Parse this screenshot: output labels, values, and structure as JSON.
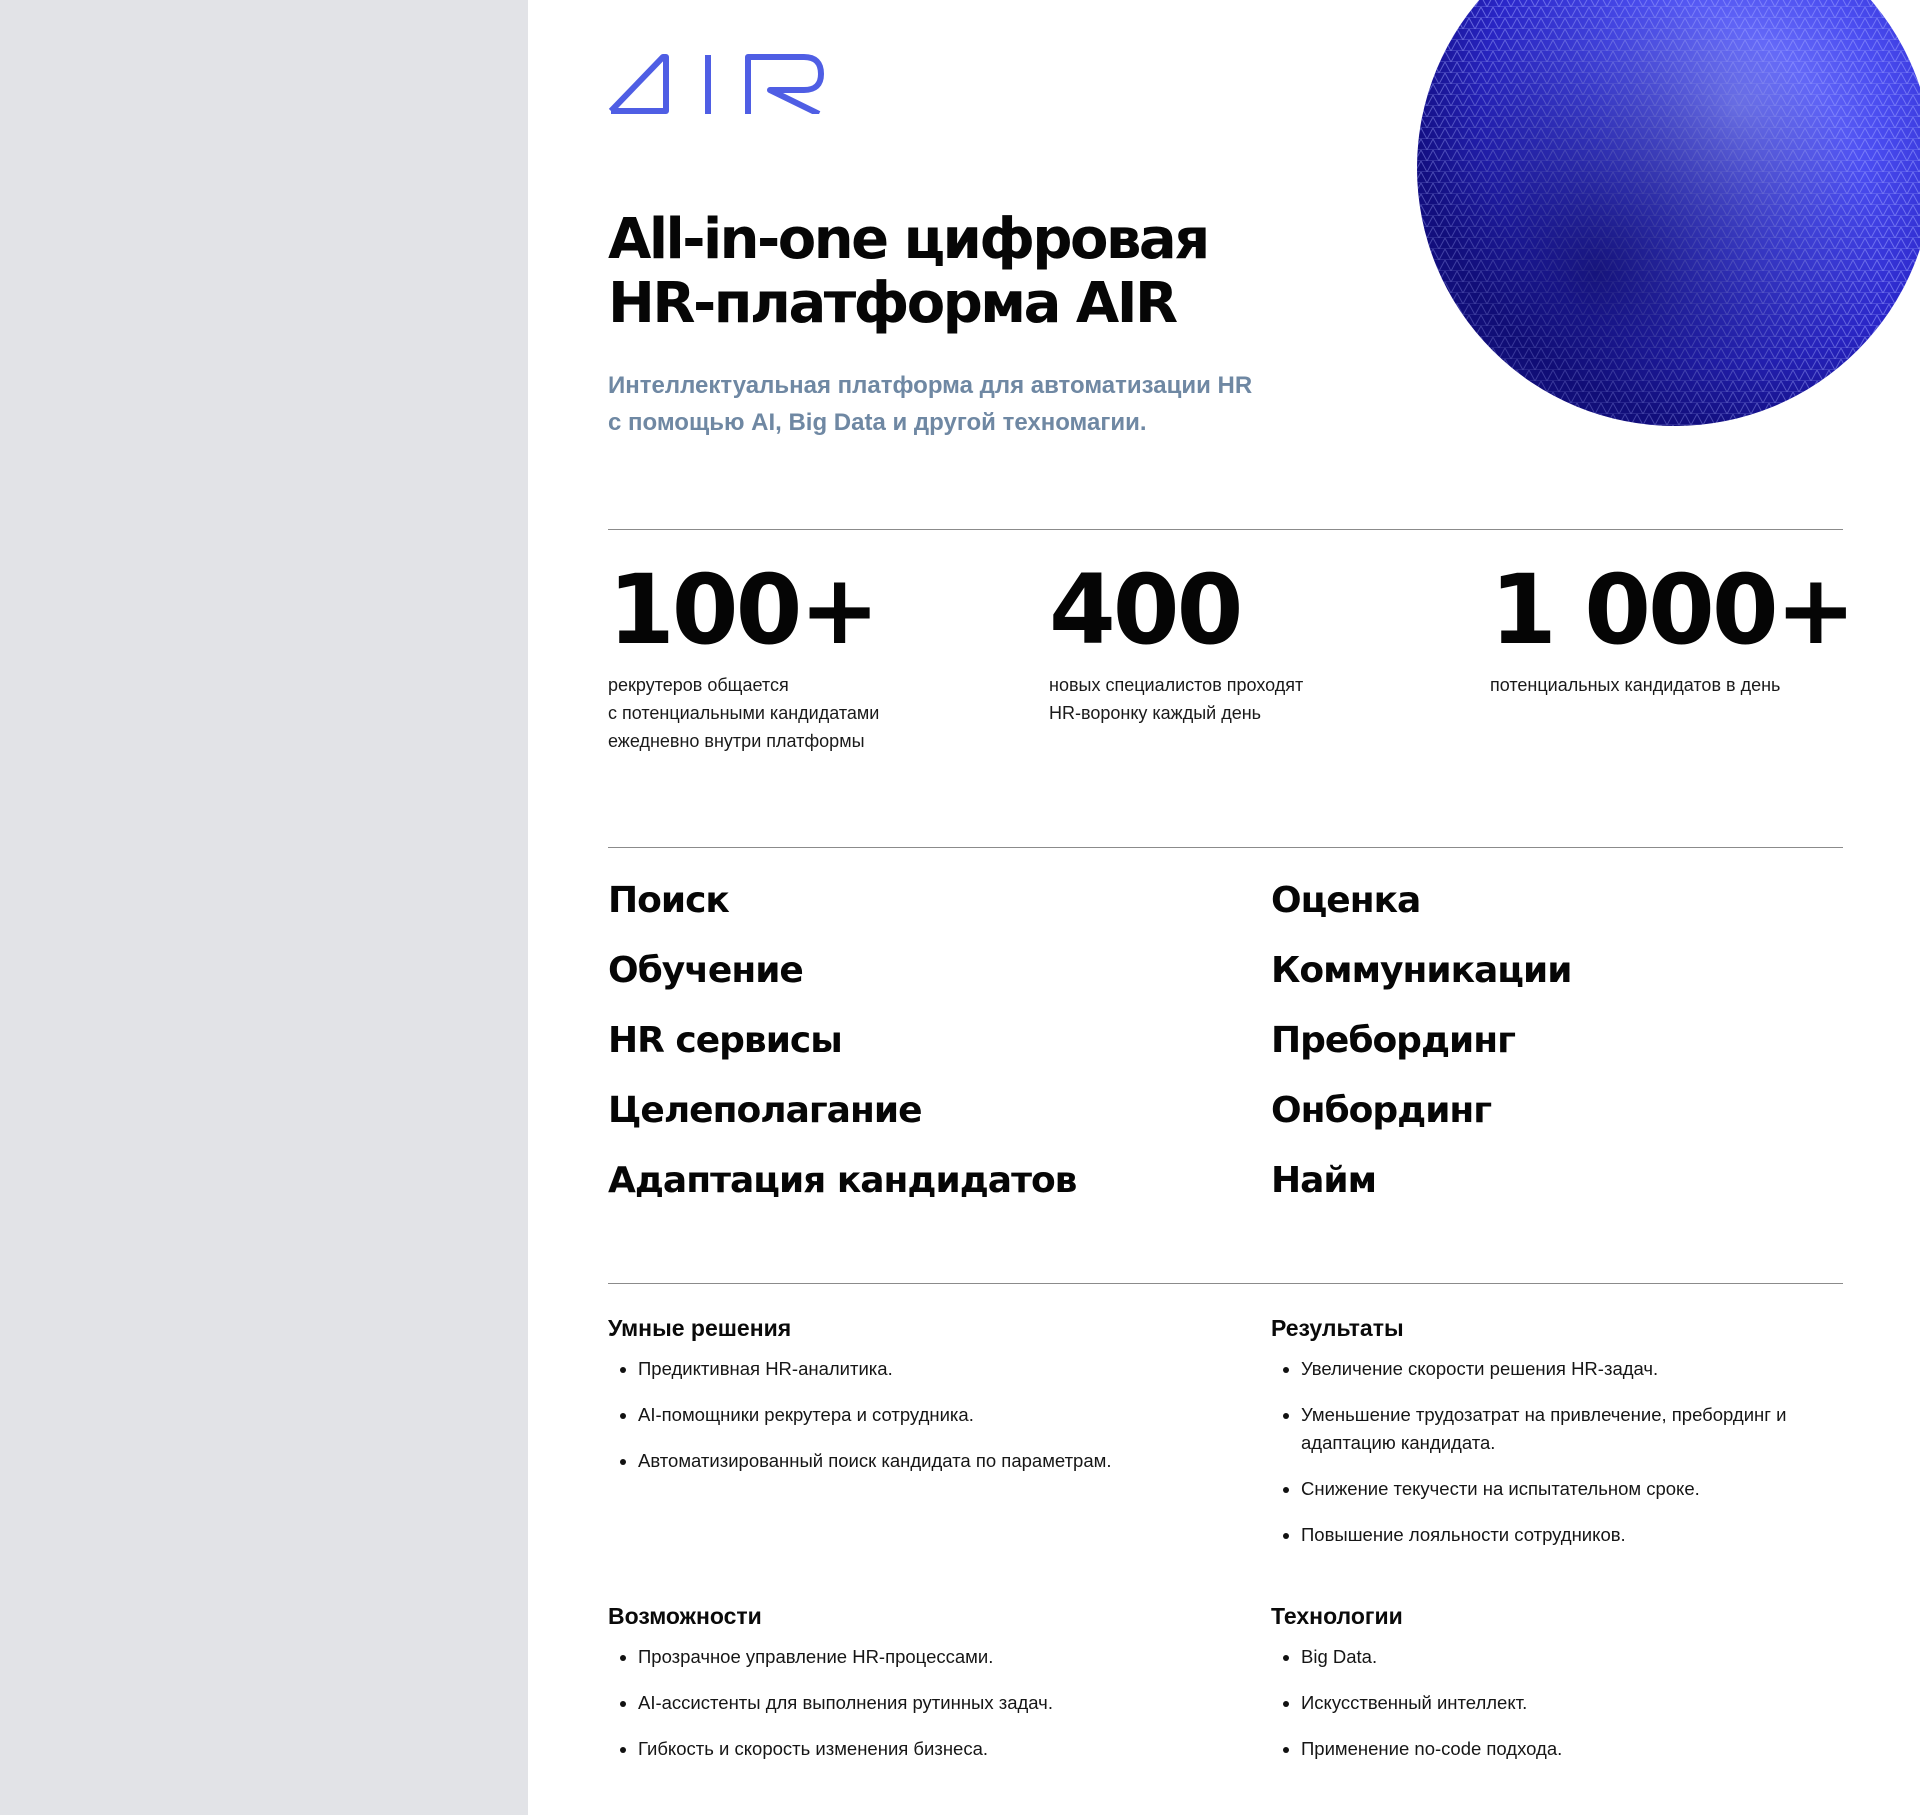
{
  "logo": {
    "text": "AIR",
    "color": "#4f5ee4"
  },
  "hero": {
    "title_line1": "All-in-one цифровая",
    "title_line2": "HR-платформа AIR",
    "subtitle_line1": "Интеллектуальная платформа для автоматизации HR",
    "subtitle_line2": "с помощью AI, Big Data и другой техномагии."
  },
  "stats": [
    {
      "value": "100+",
      "lines": [
        "рекрутеров общается",
        "с потенциальными кандидатами",
        "ежедневно внутри платформы"
      ]
    },
    {
      "value": "400",
      "lines": [
        "новых специалистов проходят",
        "HR-воронку каждый день"
      ]
    },
    {
      "value": "1 000+",
      "lines": [
        "потенциальных кандидатов в день"
      ]
    }
  ],
  "features": {
    "left": [
      "Поиск",
      "Обучение",
      "HR сервисы",
      "Целеполагание",
      "Адаптация кандидатов"
    ],
    "right": [
      "Оценка",
      "Коммуникации",
      "Пребординг",
      "Онбординг",
      "Найм"
    ]
  },
  "sections": {
    "smart": {
      "title": "Умные решения",
      "items": [
        "Предиктивная HR-аналитика.",
        "AI-помощники рекрутера и сотрудника.",
        "Автоматизированный поиск кандидата по параметрам."
      ]
    },
    "results": {
      "title": "Результаты",
      "items": [
        "Увеличение скорости решения HR-задач.",
        "Уменьшение трудозатрат на привлечение, пребординг и адаптацию кандидата.",
        "Снижение текучести на испытательном сроке.",
        "Повышение лояльности сотрудников."
      ]
    },
    "capabilities": {
      "title": "Возможности",
      "items": [
        "Прозрачное управление HR-процессами.",
        "AI-ассистенты для выполнения рутинных задач.",
        "Гибкость и скорость изменения бизнеса."
      ]
    },
    "technologies": {
      "title": "Технологии",
      "items": [
        "Big Data.",
        "Искусственный интеллект.",
        "Применение no-code подхода."
      ]
    }
  },
  "colors": {
    "page_bg": "#ffffff",
    "side_bg": "#e2e3e7",
    "subtitle": "#6f88a3",
    "sphere": "#3334d9"
  }
}
